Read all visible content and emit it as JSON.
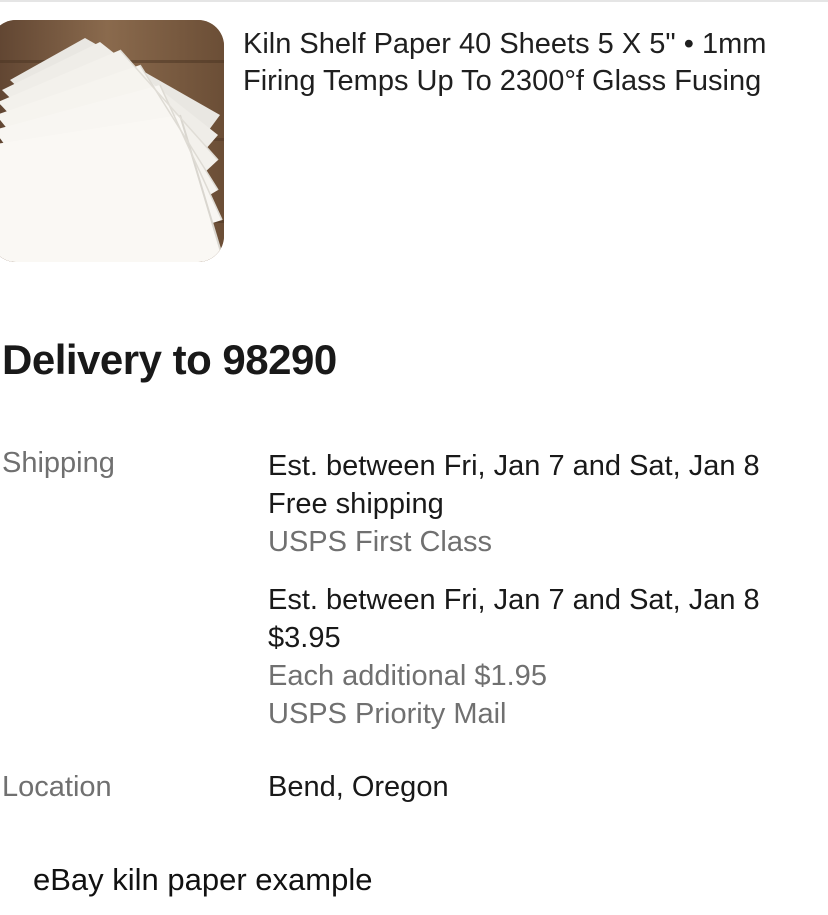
{
  "product": {
    "title_line1": "Kiln Shelf Paper 40 Sheets 5 X 5\" • 1mm",
    "title_line2": "Firing Temps Up To 2300°f Glass Fusing",
    "image": "kiln-paper-sheets-photo"
  },
  "delivery": {
    "heading": "Delivery to 98290",
    "shipping_label": "Shipping",
    "options": [
      {
        "estimate": "Est. between Fri, Jan 7 and Sat, Jan 8",
        "price": "Free shipping",
        "service": "USPS First Class"
      },
      {
        "estimate": "Est. between Fri, Jan 7 and Sat, Jan 8",
        "price": "$3.95",
        "additional": "Each additional $1.95",
        "service": "USPS Priority Mail"
      }
    ],
    "location_label": "Location",
    "location_value": "Bend, Oregon"
  },
  "caption": "eBay kiln paper example",
  "colors": {
    "primary_text": "#191919",
    "secondary_text": "#707070",
    "background": "#ffffff"
  }
}
